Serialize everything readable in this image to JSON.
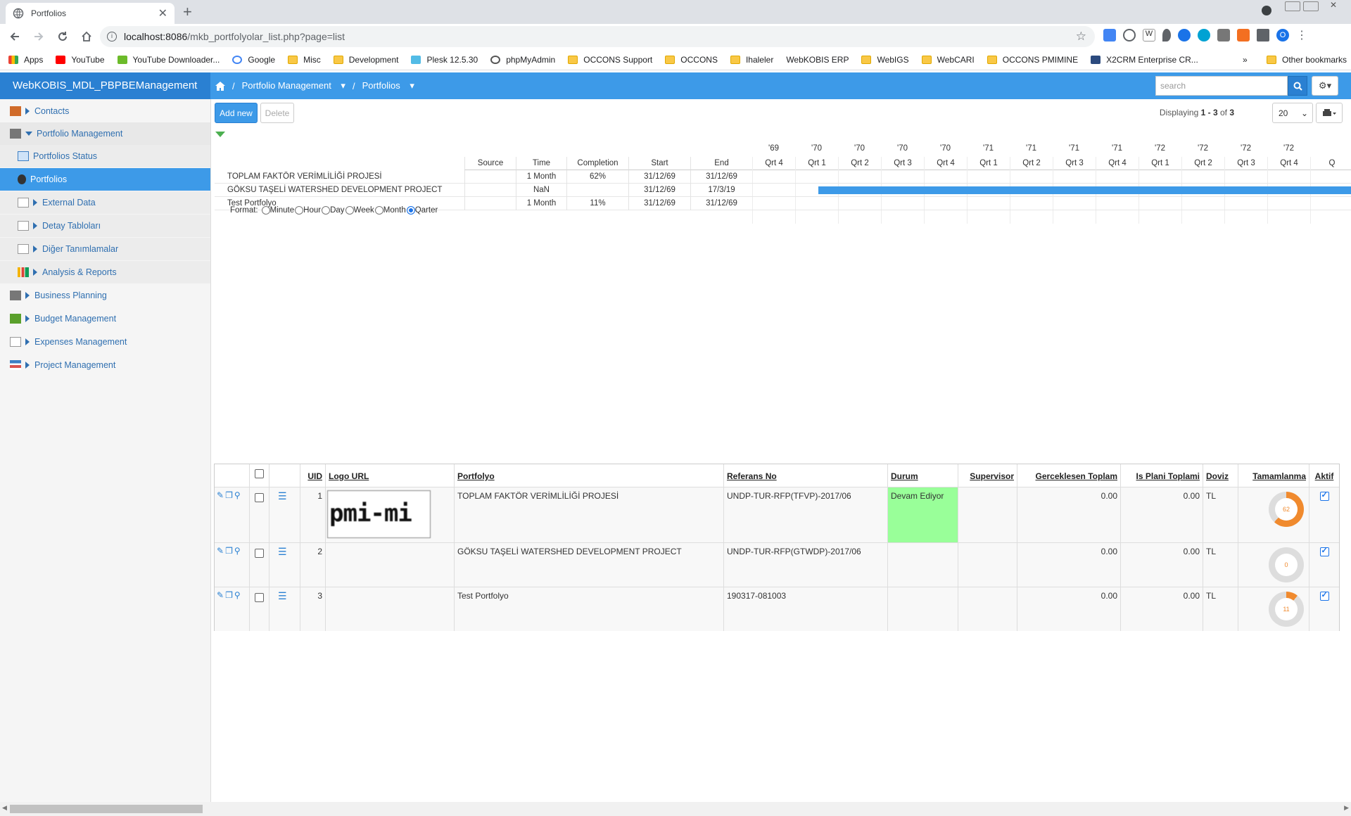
{
  "browser": {
    "tab_title": "Portfolios",
    "url_host": "localhost:8086",
    "url_path": "/mkb_portfolyolar_list.php?page=list",
    "bookmarks": [
      "Apps",
      "YouTube",
      "YouTube Downloader...",
      "Google",
      "Misc",
      "Development",
      "Plesk 12.5.30",
      "phpMyAdmin",
      "OCCONS Support",
      "OCCONS",
      "Ihaleler",
      "WebKOBIS ERP",
      "WebIGS",
      "WebCARI",
      "OCCONS PMIMINE",
      "X2CRM Enterprise CR..."
    ],
    "other_bookmarks": "Other bookmarks",
    "more": "»"
  },
  "app": {
    "brand": "WebKOBIS_MDL_PBPBEManagement",
    "crumb_1": "Portfolio Management",
    "crumb_2": "Portfolios",
    "search_placeholder": "search"
  },
  "sidebar": {
    "contacts": "Contacts",
    "portfolio_management": "Portfolio Management",
    "portfolios_status": "Portfolios Status",
    "portfolios": "Portfolios",
    "external_data": "External Data",
    "detay_tablolari": "Detay Tabloları",
    "diger_tanimlamalar": "Diğer Tanımlamalar",
    "analysis_reports": "Analysis & Reports",
    "business_planning": "Business Planning",
    "budget_management": "Budget Management",
    "expenses_management": "Expenses Management",
    "project_management": "Project Management"
  },
  "toolbar": {
    "add_new": "Add new",
    "delete": "Delete",
    "displaying_prefix": "Displaying ",
    "displaying_range": "1 - 3",
    "displaying_of": " of ",
    "displaying_total": "3",
    "page_size": "20"
  },
  "gantt": {
    "headers": {
      "source": "Source",
      "time": "Time",
      "completion": "Completion",
      "start": "Start",
      "end": "End"
    },
    "years": [
      "'69",
      "'70",
      "'70",
      "'70",
      "'70",
      "'71",
      "'71",
      "'71",
      "'71",
      "'72",
      "'72",
      "'72",
      "'72"
    ],
    "quarters": [
      "Qrt 4",
      "Qrt 1",
      "Qrt 2",
      "Qrt 3",
      "Qrt 4",
      "Qrt 1",
      "Qrt 2",
      "Qrt 3",
      "Qrt 4",
      "Qrt 1",
      "Qrt 2",
      "Qrt 3",
      "Qrt 4",
      "Q"
    ],
    "rows": [
      {
        "name": "TOPLAM FAKTÖR VERİMLİLİĞİ PROJESİ",
        "time": "1 Month",
        "completion": "62%",
        "start": "31/12/69",
        "end": "31/12/69"
      },
      {
        "name": "GÖKSU TAŞELİ WATERSHED DEVELOPMENT PROJECT",
        "time": "NaN",
        "completion": "",
        "start": "31/12/69",
        "end": "17/3/19"
      },
      {
        "name": "Test Portfolyo",
        "time": "1 Month",
        "completion": "11%",
        "start": "31/12/69",
        "end": "31/12/69"
      }
    ],
    "format_label": "Format:",
    "formats": [
      "Minute",
      "Hour",
      "Day",
      "Week",
      "Month",
      "Qarter"
    ],
    "format_selected": "Qarter"
  },
  "table": {
    "headers": {
      "uid": "UID",
      "logo": "Logo URL",
      "portfolyo": "Portfolyo",
      "referans": "Referans No",
      "durum": "Durum",
      "supervisor": "Supervisor",
      "gerceklesen": "Gerceklesen Toplam",
      "isplani": "Is Plani Toplami",
      "doviz": "Doviz",
      "tamamlanma": "Tamamlanma",
      "aktif": "Aktif"
    },
    "logo_text": "pmi-mi",
    "rows": [
      {
        "uid": "1",
        "portfolyo": "TOPLAM FAKTÖR VERİMLİLİĞİ PROJESİ",
        "referans": "UNDP-TUR-RFP(TFVP)-2017/06",
        "durum": "Devam Ediyor",
        "gerceklesen": "0.00",
        "isplani": "0.00",
        "doviz": "TL",
        "tamamlanma": "62",
        "tamamlanma_pct": 62
      },
      {
        "uid": "2",
        "portfolyo": "GÖKSU TAŞELİ WATERSHED DEVELOPMENT PROJECT",
        "referans": "UNDP-TUR-RFP(GTWDP)-2017/06",
        "durum": "",
        "gerceklesen": "0.00",
        "isplani": "0.00",
        "doviz": "TL",
        "tamamlanma": "0",
        "tamamlanma_pct": 0
      },
      {
        "uid": "3",
        "portfolyo": "Test Portfolyo",
        "referans": "190317-081003",
        "durum": "",
        "gerceklesen": "0.00",
        "isplani": "0.00",
        "doviz": "TL",
        "tamamlanma": "11",
        "tamamlanma_pct": 11
      }
    ]
  },
  "colors": {
    "accent": "#3d9ae8",
    "brand_bg": "#2a80d2",
    "status_green": "#99ff99",
    "donut_fill": "#f08a2e",
    "donut_track": "#dddddd"
  }
}
